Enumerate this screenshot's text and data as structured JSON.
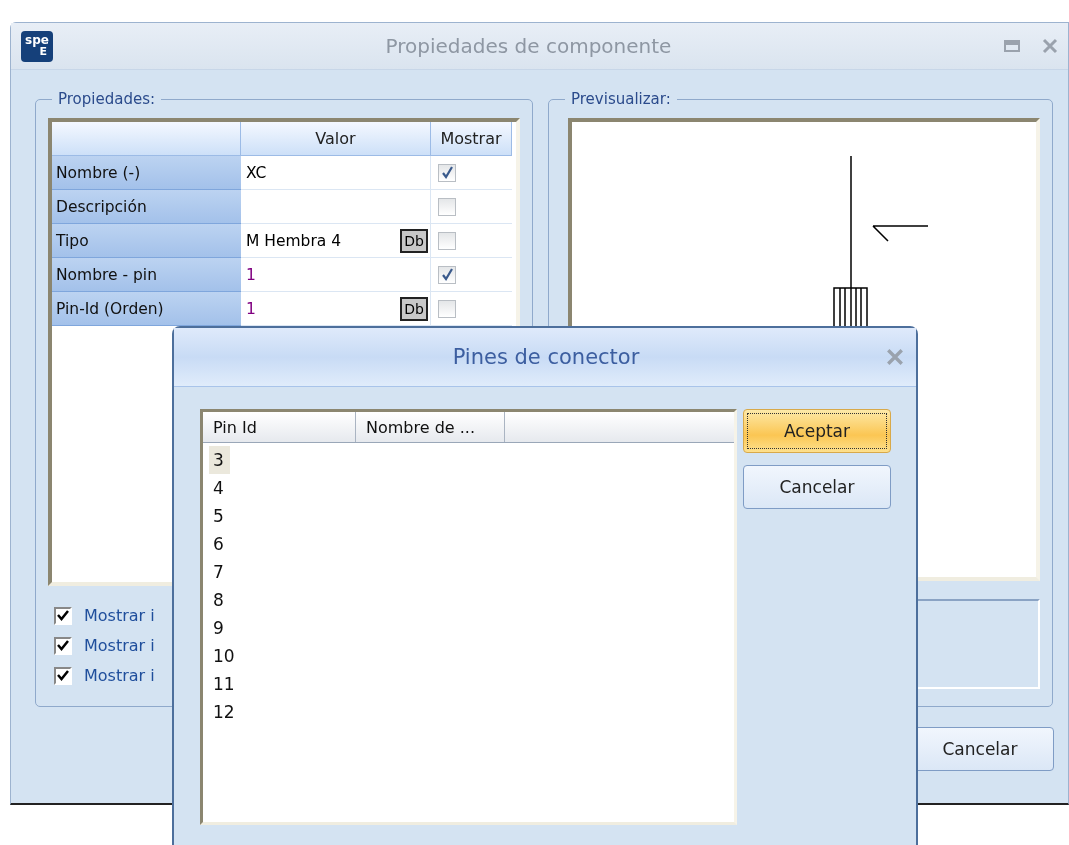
{
  "window": {
    "title": "Propiedades de componente",
    "logo": {
      "top": "spe",
      "bottom": "E"
    }
  },
  "properties": {
    "legend": "Propiedades:",
    "columns": [
      "Valor",
      "Mostrar"
    ],
    "rows": [
      {
        "name": "Nombre (-)",
        "value": "XC",
        "color": "#000000",
        "db": "",
        "show": true
      },
      {
        "name": "Descripción",
        "value": "",
        "db": "",
        "show": false
      },
      {
        "name": "Tipo",
        "value": "M Hembra 4",
        "color": "#000000",
        "db": "Db",
        "show": false
      },
      {
        "name": "Nombre - pin",
        "value": "1",
        "color": "#800080",
        "db": "",
        "show": true
      },
      {
        "name": "Pin-Id (Orden)",
        "value": "1",
        "color": "#800080",
        "db": "Db",
        "show": false
      }
    ],
    "options": [
      {
        "label": "Mostrar i",
        "checked": true
      },
      {
        "label": "Mostrar i",
        "checked": true
      },
      {
        "label": "Mostrar i",
        "checked": true
      }
    ]
  },
  "preview": {
    "legend": "Previsualizar:"
  },
  "cancel_button": "Cancelar",
  "dialog": {
    "title": "Pines de conector",
    "columns": [
      "Pin Id",
      "Nombre de ..."
    ],
    "pins": [
      {
        "id": "3",
        "selected": true
      },
      {
        "id": "4",
        "selected": false
      },
      {
        "id": "5",
        "selected": false
      },
      {
        "id": "6",
        "selected": false
      },
      {
        "id": "7",
        "selected": false
      },
      {
        "id": "8",
        "selected": false
      },
      {
        "id": "9",
        "selected": false
      },
      {
        "id": "10",
        "selected": false
      },
      {
        "id": "11",
        "selected": false
      },
      {
        "id": "12",
        "selected": false
      }
    ],
    "buttons": [
      {
        "label": "Aceptar",
        "kind": "default"
      },
      {
        "label": "Cancelar",
        "kind": "normal"
      }
    ]
  }
}
